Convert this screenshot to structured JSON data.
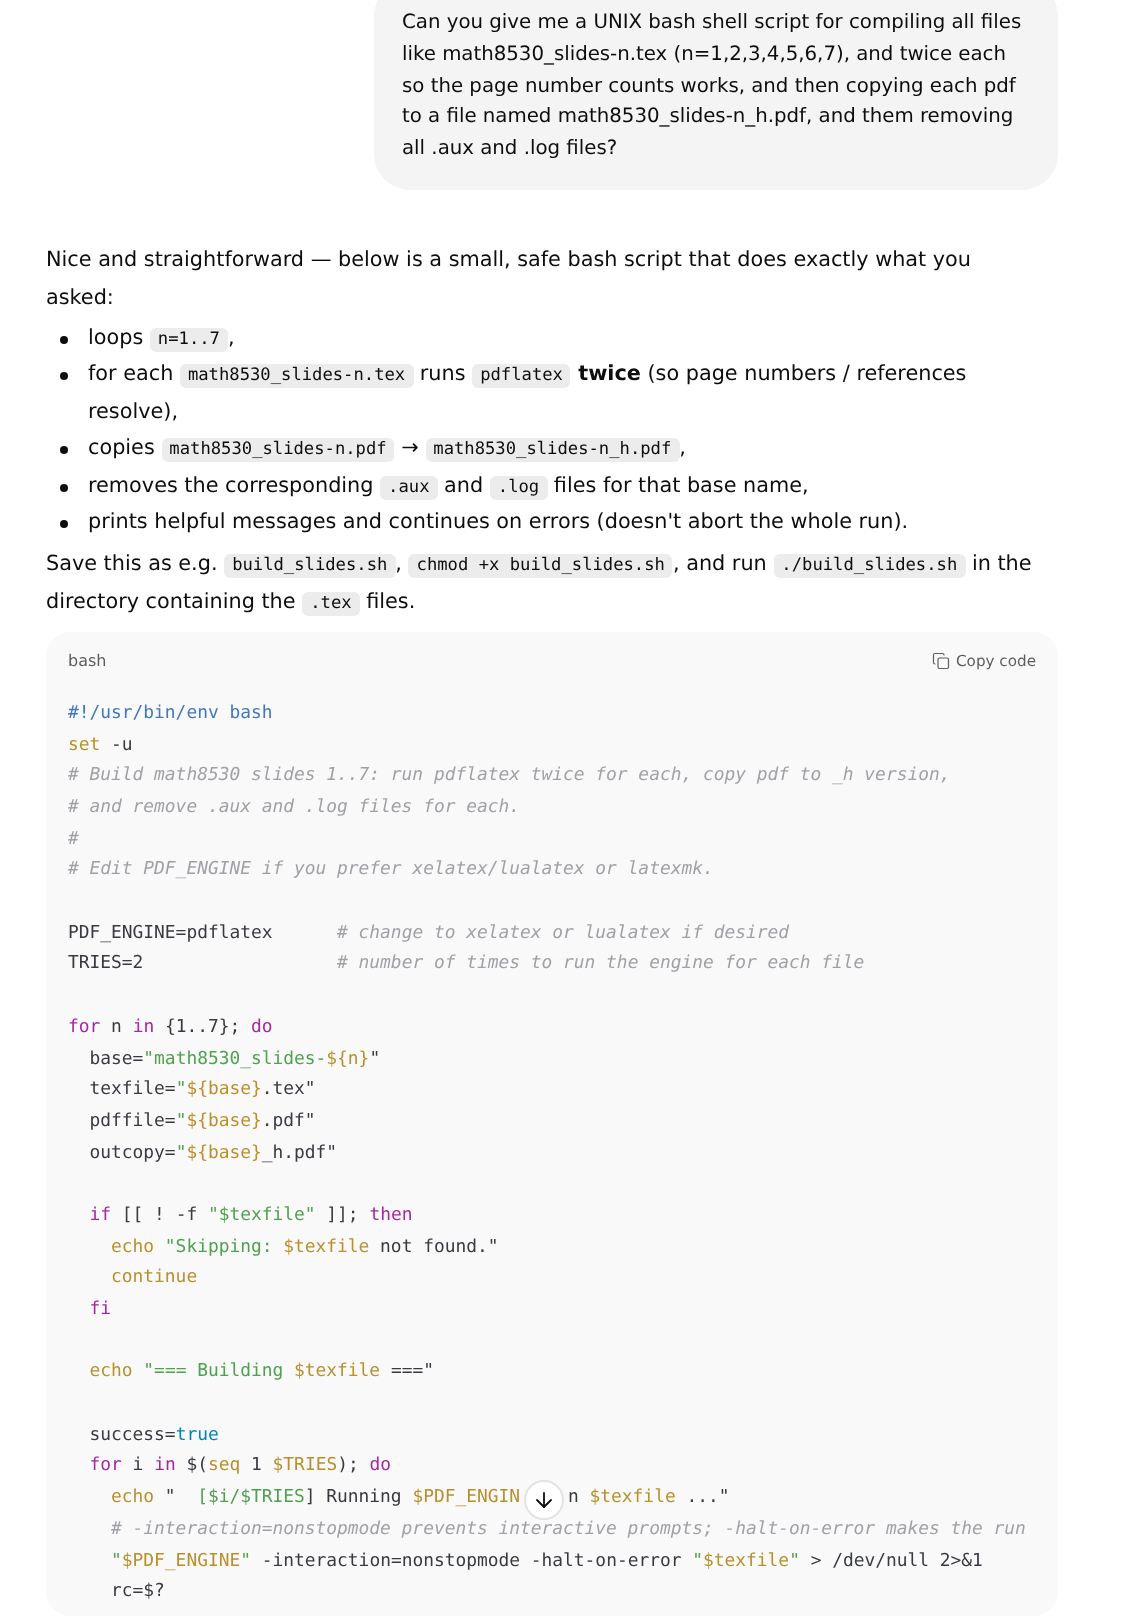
{
  "user_message": "Can you give me a UNIX bash shell script for compiling all files like math8530_slides-n.tex (n=1,2,3,4,5,6,7), and twice each so the page number counts works, and then copying each pdf to a file named math8530_slides-n_h.pdf, and them removing all .aux and .log files?",
  "intro": [
    {
      "kind": "text",
      "t": "Nice and straightforward — below is a small, safe bash script that does exactly what you asked:"
    }
  ],
  "bullets": [
    [
      {
        "kind": "text",
        "t": "loops "
      },
      {
        "kind": "code",
        "t": "n=1..7"
      },
      {
        "kind": "text",
        "t": ","
      }
    ],
    [
      {
        "kind": "text",
        "t": "for each "
      },
      {
        "kind": "code",
        "t": "math8530_slides-n.tex"
      },
      {
        "kind": "text",
        "t": " runs "
      },
      {
        "kind": "code",
        "t": "pdflatex"
      },
      {
        "kind": "bold",
        "t": " twice"
      },
      {
        "kind": "text",
        "t": " (so page numbers / references resolve),"
      }
    ],
    [
      {
        "kind": "text",
        "t": "copies "
      },
      {
        "kind": "code",
        "t": "math8530_slides-n.pdf"
      },
      {
        "kind": "text",
        "t": " → "
      },
      {
        "kind": "code",
        "t": "math8530_slides-n_h.pdf"
      },
      {
        "kind": "text",
        "t": ","
      }
    ],
    [
      {
        "kind": "text",
        "t": "removes the corresponding "
      },
      {
        "kind": "code",
        "t": ".aux"
      },
      {
        "kind": "text",
        "t": " and "
      },
      {
        "kind": "code",
        "t": ".log"
      },
      {
        "kind": "text",
        "t": " files for that base name,"
      }
    ],
    [
      {
        "kind": "text",
        "t": "prints helpful messages and continues on errors (doesn't abort the whole run)."
      }
    ]
  ],
  "outro": [
    {
      "kind": "text",
      "t": "Save this as e.g. "
    },
    {
      "kind": "code",
      "t": "build_slides.sh"
    },
    {
      "kind": "text",
      "t": ", "
    },
    {
      "kind": "code",
      "t": "chmod +x build_slides.sh"
    },
    {
      "kind": "text",
      "t": ", and run "
    },
    {
      "kind": "code",
      "t": "./build_slides.sh"
    },
    {
      "kind": "text",
      "t": " in the directory containing the "
    },
    {
      "kind": "code",
      "t": ".tex"
    },
    {
      "kind": "text",
      "t": " files."
    }
  ],
  "code_block": {
    "language": "bash",
    "copy_label": "Copy code",
    "lines": [
      {
        "kind": "code",
        "tokens": [
          {
            "kind": "shebang",
            "t": "#!/usr/bin/env bash"
          }
        ]
      },
      {
        "kind": "code",
        "tokens": [
          {
            "kind": "builtin",
            "t": "set"
          },
          {
            "kind": "plain",
            "t": " -u"
          }
        ]
      },
      {
        "kind": "code",
        "tokens": [
          {
            "kind": "comment",
            "t": "# Build math8530 slides 1..7: run pdflatex twice for each, copy pdf to _h version,"
          }
        ]
      },
      {
        "kind": "code",
        "tokens": [
          {
            "kind": "comment",
            "t": "# and remove .aux and .log files for each."
          }
        ]
      },
      {
        "kind": "code",
        "tokens": [
          {
            "kind": "comment",
            "t": "#"
          }
        ]
      },
      {
        "kind": "code",
        "tokens": [
          {
            "kind": "comment",
            "t": "# Edit PDF_ENGINE if you prefer xelatex/lualatex or latexmk."
          }
        ]
      },
      {
        "kind": "blank"
      },
      {
        "kind": "code",
        "tokens": [
          {
            "kind": "plain",
            "t": "PDF_ENGINE=pdflatex      "
          },
          {
            "kind": "comment",
            "t": "# change to xelatex or lualatex if desired"
          }
        ]
      },
      {
        "kind": "code",
        "tokens": [
          {
            "kind": "plain",
            "t": "TRIES=2                  "
          },
          {
            "kind": "comment",
            "t": "# number of times to run the engine for each file"
          }
        ]
      },
      {
        "kind": "blank"
      },
      {
        "kind": "code",
        "tokens": [
          {
            "kind": "keyword",
            "t": "for"
          },
          {
            "kind": "plain",
            "t": " n "
          },
          {
            "kind": "keyword",
            "t": "in"
          },
          {
            "kind": "plain",
            "t": " {1..7}; "
          },
          {
            "kind": "keyword",
            "t": "do"
          }
        ]
      },
      {
        "kind": "code",
        "tokens": [
          {
            "kind": "plain",
            "t": "  base="
          },
          {
            "kind": "string",
            "t": "\"math8530_slides-"
          },
          {
            "kind": "variable",
            "t": "${n}"
          },
          {
            "kind": "plain",
            "t": "\""
          }
        ]
      },
      {
        "kind": "code",
        "tokens": [
          {
            "kind": "plain",
            "t": "  texfile="
          },
          {
            "kind": "string",
            "t": "\""
          },
          {
            "kind": "variable",
            "t": "${base}"
          },
          {
            "kind": "plain",
            "t": ".tex\""
          }
        ]
      },
      {
        "kind": "code",
        "tokens": [
          {
            "kind": "plain",
            "t": "  pdffile="
          },
          {
            "kind": "string",
            "t": "\""
          },
          {
            "kind": "variable",
            "t": "${base}"
          },
          {
            "kind": "plain",
            "t": ".pdf\""
          }
        ]
      },
      {
        "kind": "code",
        "tokens": [
          {
            "kind": "plain",
            "t": "  outcopy="
          },
          {
            "kind": "string",
            "t": "\""
          },
          {
            "kind": "variable",
            "t": "${base}"
          },
          {
            "kind": "plain",
            "t": "_h.pdf\""
          }
        ]
      },
      {
        "kind": "blank"
      },
      {
        "kind": "code",
        "tokens": [
          {
            "kind": "keyword",
            "t": "  if"
          },
          {
            "kind": "plain",
            "t": " [[ ! -f "
          },
          {
            "kind": "string",
            "t": "\"$texfile\""
          },
          {
            "kind": "plain",
            "t": " ]]; "
          },
          {
            "kind": "keyword",
            "t": "then"
          }
        ]
      },
      {
        "kind": "code",
        "tokens": [
          {
            "kind": "builtin",
            "t": "    echo"
          },
          {
            "kind": "string",
            "t": " \"Skipping: "
          },
          {
            "kind": "variable",
            "t": "$texfile"
          },
          {
            "kind": "plain",
            "t": " not found.\""
          }
        ]
      },
      {
        "kind": "code",
        "tokens": [
          {
            "kind": "builtin",
            "t": "    continue"
          }
        ]
      },
      {
        "kind": "code",
        "tokens": [
          {
            "kind": "keyword",
            "t": "  fi"
          }
        ]
      },
      {
        "kind": "blank"
      },
      {
        "kind": "code",
        "tokens": [
          {
            "kind": "builtin",
            "t": "  echo"
          },
          {
            "kind": "string",
            "t": " \"=== Building "
          },
          {
            "kind": "variable",
            "t": "$texfile"
          },
          {
            "kind": "plain",
            "t": " ===\""
          }
        ]
      },
      {
        "kind": "blank"
      },
      {
        "kind": "code",
        "tokens": [
          {
            "kind": "plain",
            "t": "  success="
          },
          {
            "kind": "boolean",
            "t": "true"
          }
        ]
      },
      {
        "kind": "code",
        "tokens": [
          {
            "kind": "keyword",
            "t": "  for"
          },
          {
            "kind": "plain",
            "t": " i "
          },
          {
            "kind": "keyword",
            "t": "in"
          },
          {
            "kind": "plain",
            "t": " $("
          },
          {
            "kind": "builtin",
            "t": "seq"
          },
          {
            "kind": "plain",
            "t": " 1 "
          },
          {
            "kind": "variable",
            "t": "$TRIES"
          },
          {
            "kind": "plain",
            "t": "); "
          },
          {
            "kind": "keyword",
            "t": "do"
          }
        ]
      },
      {
        "kind": "split",
        "tokens": [
          {
            "kind": "builtin",
            "t": "    echo"
          },
          {
            "kind": "plain",
            "t": " \"  "
          },
          {
            "kind": "string",
            "t": "[$i/$TRIES"
          },
          {
            "kind": "plain",
            "t": "] Running "
          },
          {
            "kind": "variable",
            "t": "$PDF_ENGIN"
          }
        ],
        "after": [
          {
            "kind": "plain",
            "t": "n "
          },
          {
            "kind": "variable",
            "t": "$texfile"
          },
          {
            "kind": "plain",
            "t": " ...\""
          }
        ]
      },
      {
        "kind": "code",
        "tokens": [
          {
            "kind": "comment",
            "t": "    # -interaction=nonstopmode prevents interactive prompts; -halt-on-error makes the run"
          }
        ]
      },
      {
        "kind": "code",
        "tokens": [
          {
            "kind": "string",
            "t": "    \""
          },
          {
            "kind": "variable",
            "t": "$PDF_ENGINE"
          },
          {
            "kind": "string",
            "t": "\""
          },
          {
            "kind": "plain",
            "t": " -interaction=nonstopmode -halt-on-error "
          },
          {
            "kind": "string",
            "t": "\""
          },
          {
            "kind": "variable",
            "t": "$texfile"
          },
          {
            "kind": "string",
            "t": "\""
          },
          {
            "kind": "plain",
            "t": " > /dev/null 2>&1"
          }
        ]
      },
      {
        "kind": "code",
        "tokens": [
          {
            "kind": "plain",
            "t": "    rc=$?"
          }
        ]
      }
    ]
  }
}
